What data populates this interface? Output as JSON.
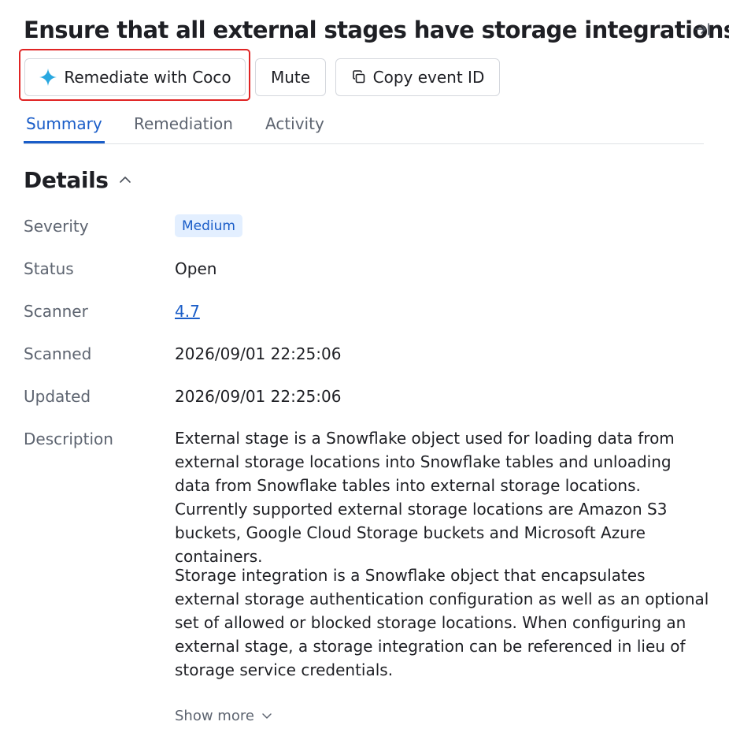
{
  "header": {
    "title": "Ensure that all external stages have storage integrations",
    "collapse_icon": "collapse-panel-icon"
  },
  "actions": {
    "remediate_label": "Remediate with Coco",
    "remediate_icon": "sparkle-icon",
    "mute_label": "Mute",
    "copy_label": "Copy event ID",
    "copy_icon": "copy-icon",
    "highlight_color": "#e02424"
  },
  "tabs": [
    {
      "label": "Summary",
      "active": true
    },
    {
      "label": "Remediation",
      "active": false
    },
    {
      "label": "Activity",
      "active": false
    }
  ],
  "details": {
    "section_title": "Details",
    "rows": {
      "severity": {
        "label": "Severity",
        "value": "Medium"
      },
      "status": {
        "label": "Status",
        "value": "Open"
      },
      "scanner": {
        "label": "Scanner",
        "value": "4.7"
      },
      "scanned": {
        "label": "Scanned",
        "value": "2026/09/01 22:25:06"
      },
      "updated": {
        "label": "Updated",
        "value": "2026/09/01 22:25:06"
      },
      "description": {
        "label": "Description",
        "paragraphs": [
          "External stage is a Snowflake object used for loading data from external storage locations into Snowflake tables and unloading data from Snowflake tables into external storage locations. Currently supported external storage locations are Amazon S3 buckets, Google Cloud Storage buckets and Microsoft Azure containers.",
          "Storage integration is a Snowflake object that encapsulates external storage authentication configuration as well as an optional set of allowed or blocked storage locations. When configuring an external stage, a storage integration can be referenced in lieu of storage service credentials."
        ]
      }
    },
    "show_more_label": "Show more"
  },
  "colors": {
    "accent": "#1a5dc8",
    "badge_bg": "#e3efff",
    "sparkle": "#29a8e0"
  }
}
